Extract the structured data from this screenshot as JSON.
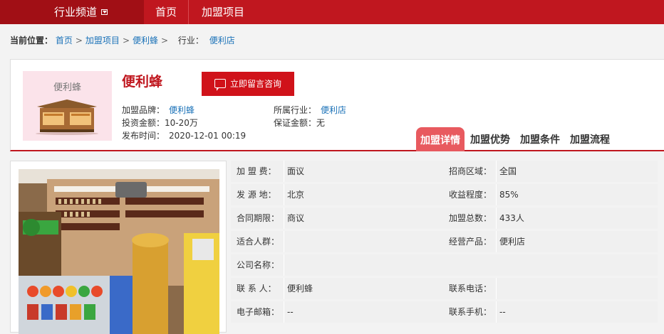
{
  "topnav": {
    "channel": "行业频道",
    "items": [
      "首页",
      "加盟项目"
    ]
  },
  "breadcrumb": {
    "label": "当前位置：",
    "links": [
      "首页",
      "加盟项目",
      "便利蜂"
    ],
    "industry_label": "行业：",
    "industry": "便利店"
  },
  "brand": {
    "logo_text": "便利蜂",
    "title": "便利蜂",
    "consult_button": "立即留言咨询",
    "fields": {
      "brand_label": "加盟品牌：",
      "brand_value": "便利蜂",
      "industry_label": "所属行业：",
      "industry_value": "便利店",
      "invest_label": "投资金额：",
      "invest_value": "10-20万",
      "deposit_label": "保证金额：",
      "deposit_value": "无",
      "date_label": "发布时间：",
      "date_value": "2020-12-01 00:19"
    }
  },
  "tabs": [
    "加盟详情",
    "加盟优势",
    "加盟条件",
    "加盟流程"
  ],
  "details": [
    {
      "k1": "加 盟 费：",
      "v1": "面议",
      "k2": "招商区域：",
      "v2": "全国"
    },
    {
      "k1": "发 源 地：",
      "v1": "北京",
      "k2": "收益程度：",
      "v2": "85%"
    },
    {
      "k1": "合同期限：",
      "v1": "商议",
      "k2": "加盟总数：",
      "v2": "433人"
    },
    {
      "k1": "适合人群：",
      "v1": "",
      "k2": "经营产品：",
      "v2": "便利店"
    },
    {
      "k1": "公司名称：",
      "v1": "",
      "k2": "",
      "v2": ""
    },
    {
      "k1": "联 系 人：",
      "v1": "便利蜂",
      "k2": "联系电话：",
      "v2": ""
    },
    {
      "k1": "电子邮箱：",
      "v1": "--",
      "k2": "联系手机：",
      "v2": "--"
    }
  ],
  "colors": {
    "brand_red": "#c0171f",
    "link_blue": "#1b72b8",
    "tab_active": "#e85a5f"
  }
}
